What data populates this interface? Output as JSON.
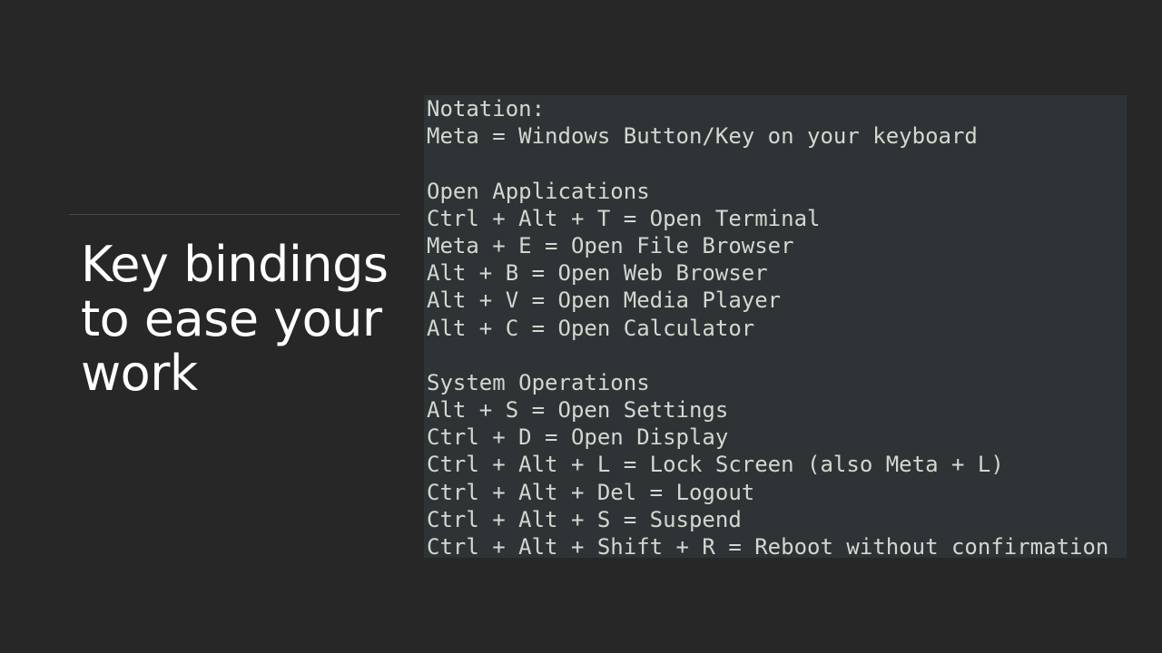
{
  "slide": {
    "title_lines": [
      "Key bindings",
      "to ease your",
      "work"
    ]
  },
  "code": {
    "lines": [
      "Notation:",
      "Meta = Windows Button/Key on your keyboard",
      "",
      "Open Applications",
      "Ctrl + Alt + T = Open Terminal",
      "Meta + E = Open File Browser",
      "Alt + B = Open Web Browser",
      "Alt + V = Open Media Player",
      "Alt + C = Open Calculator",
      "",
      "System Operations",
      "Alt + S = Open Settings",
      "Ctrl + D = Open Display",
      "Ctrl + Alt + L = Lock Screen (also Meta + L)",
      "Ctrl + Alt + Del = Logout",
      "Ctrl + Alt + S = Suspend",
      "Ctrl + Alt + Shift + R = Reboot without confirmation"
    ]
  },
  "colors": {
    "background": "#272727",
    "panel": "#2e3436",
    "code_text": "#d3d7cf",
    "title_text": "#ffffff"
  }
}
